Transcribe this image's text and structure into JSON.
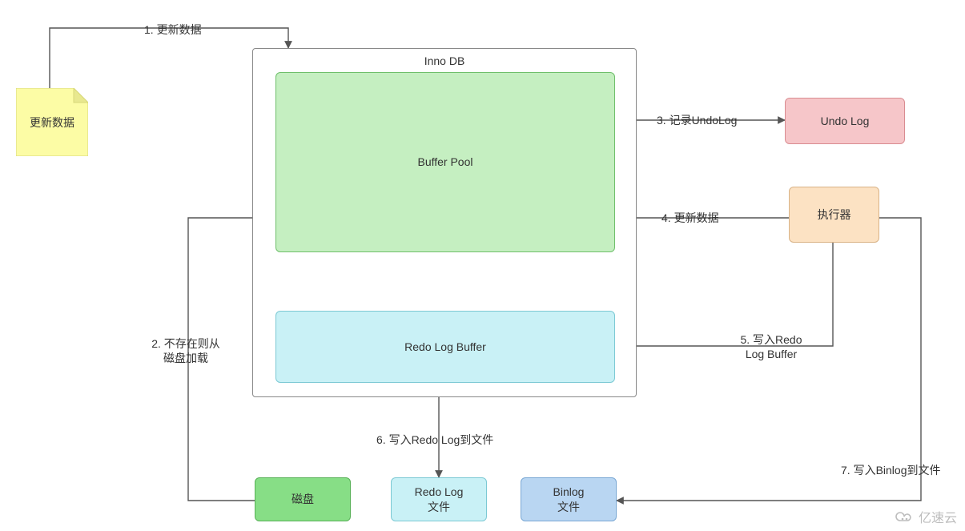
{
  "nodes": {
    "update_data_note": {
      "label": "更新数据",
      "fill": "#fcfca5",
      "stroke": "#d9d97a"
    },
    "innodb_container": {
      "label": "Inno DB",
      "fill": "#ffffff",
      "stroke": "#888888"
    },
    "buffer_pool": {
      "label": "Buffer Pool",
      "fill": "#c5efc1",
      "stroke": "#6fbf6b"
    },
    "redo_log_buffer": {
      "label": "Redo Log Buffer",
      "fill": "#c9f1f6",
      "stroke": "#7cc9d4"
    },
    "undo_log": {
      "label": "Undo Log",
      "fill": "#f6c6c9",
      "stroke": "#d98c91"
    },
    "executor": {
      "label": "执行器",
      "fill": "#fce2c3",
      "stroke": "#d9b387"
    },
    "disk": {
      "label": "磁盘",
      "fill": "#87de86",
      "stroke": "#58b157"
    },
    "redo_log_file": {
      "label": "Redo Log\n文件",
      "fill": "#c9f1f6",
      "stroke": "#7cc9d4"
    },
    "binlog_file": {
      "label": "Binlog\n文件",
      "fill": "#b9d6f2",
      "stroke": "#7aa8d4"
    }
  },
  "edges": {
    "e1": "1. 更新数据",
    "e2": "2. 不存在则从\n磁盘加载",
    "e3": "3. 记录UndoLog",
    "e4": "4. 更新数据",
    "e5": "5. 写入Redo\nLog Buffer",
    "e6": "6. 写入Redo Log到文件",
    "e7": "7. 写入Binlog到文件"
  },
  "watermark": "亿速云"
}
